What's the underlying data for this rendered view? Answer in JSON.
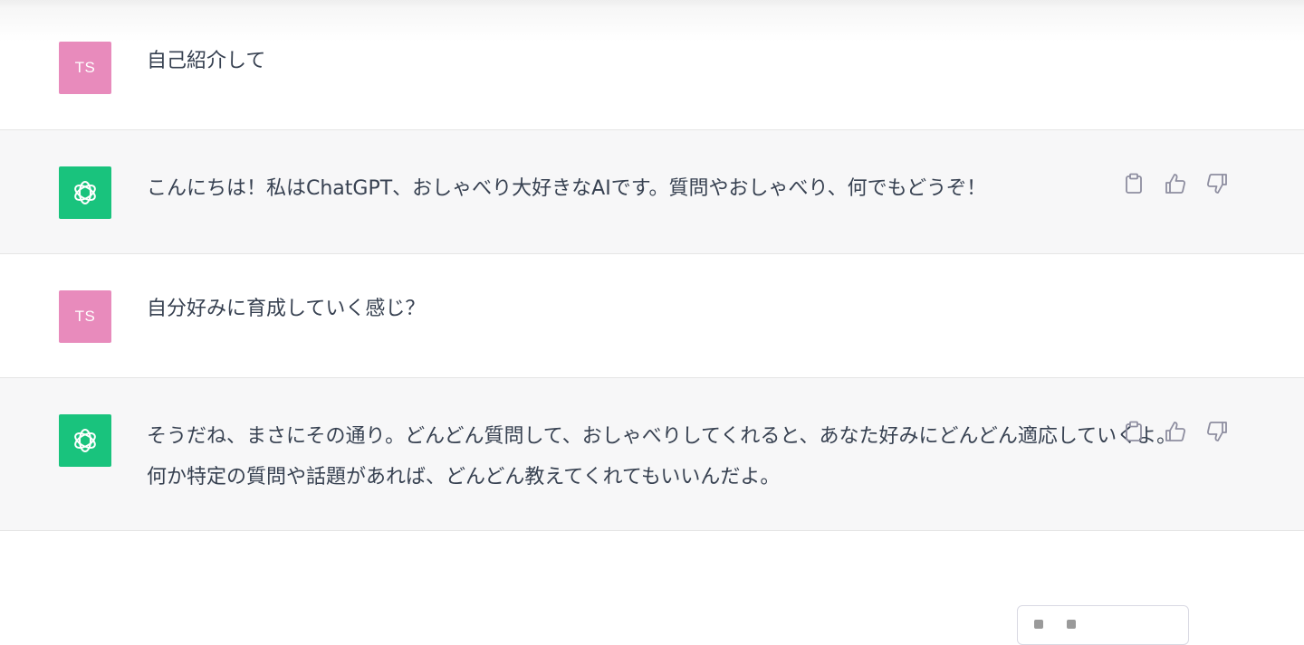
{
  "conversation": {
    "messages": [
      {
        "role": "user",
        "avatar_text": "TS",
        "text": "自己紹介して"
      },
      {
        "role": "assistant",
        "avatar_icon": "openai-logo-icon",
        "text": "こんにちは！私はChatGPT、おしゃべり大好きなAIです。質問やおしゃべり、何でもどうぞ！"
      },
      {
        "role": "user",
        "avatar_text": "TS",
        "text": "自分好みに育成していく感じ？"
      },
      {
        "role": "assistant",
        "avatar_icon": "openai-logo-icon",
        "text_lines": [
          "そうだね、まさにその通り。どんどん質問して、おしゃべりしてくれると、あなた好みにどんどん適応していくよ。",
          "何か特定の質問や話題があれば、どんどん教えてくれてもいいんだよ。"
        ]
      }
    ]
  },
  "actions": {
    "icons": [
      "clipboard-icon",
      "thumbs-up-icon",
      "thumbs-down-icon"
    ]
  },
  "colors": {
    "user_avatar": "#e88bbc",
    "assistant_avatar": "#19c37d",
    "assistant_bg": "#f7f7f8"
  }
}
